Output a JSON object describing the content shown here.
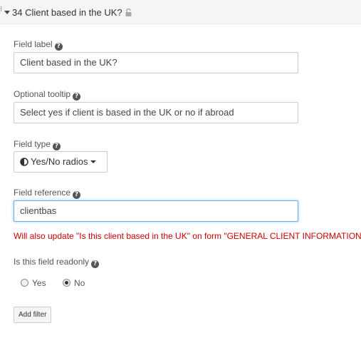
{
  "header": {
    "drag_glyph": "⁝",
    "title": "34 Client based in the UK?",
    "lock_icon": "lock-icon"
  },
  "fields": {
    "label": {
      "label": "Field label",
      "value": "Client based in the UK?"
    },
    "tooltip": {
      "label": "Optional tooltip",
      "value": "Select yes if client is based in the UK or no if abroad"
    },
    "type": {
      "label": "Field type",
      "value": "Yes/No radios"
    },
    "reference": {
      "label": "Field reference",
      "value": "clientbas",
      "warning": "Will also update \"Is this client based in the UK\" on form \"GENERAL CLIENT INFORMATION\""
    },
    "readonly": {
      "label": "Is this field readonly",
      "options": [
        "Yes",
        "No"
      ],
      "selected": "No"
    }
  },
  "help_glyph": "?",
  "add_filter_label": "Add filter",
  "colors": {
    "warning": "#cc0000",
    "focus_border": "#66afe9",
    "header_bg": "#f5f5f5"
  }
}
